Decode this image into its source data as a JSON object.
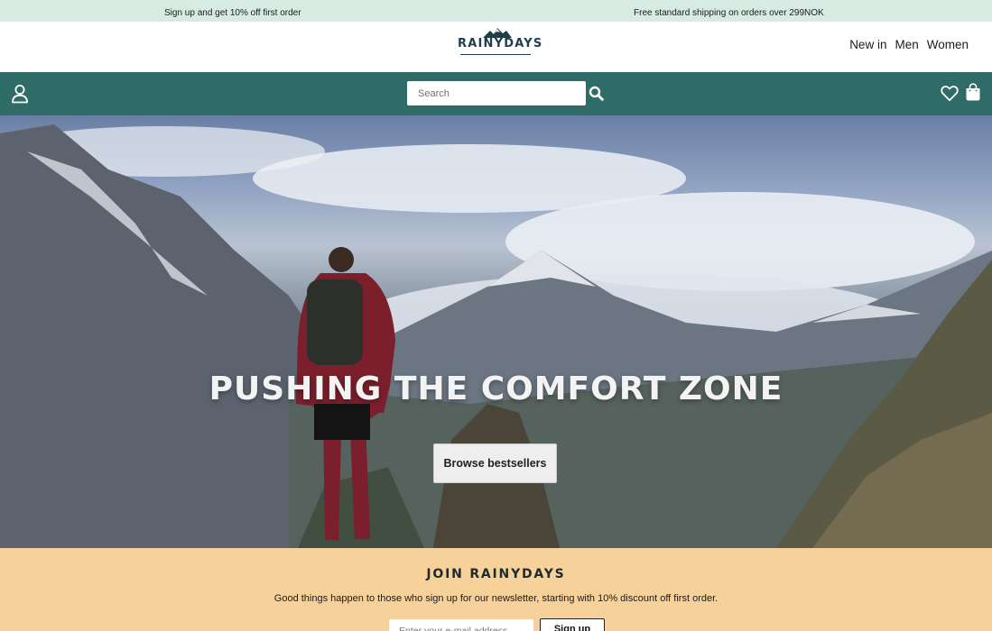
{
  "promo": {
    "signup_offer": "Sign up and get 10% off first order",
    "shipping": "Free standard shipping on orders over 299NOK"
  },
  "header": {
    "logo_text": "RAINYDAYS",
    "nav": {
      "new_in": "New in",
      "men": "Men",
      "women": "Women"
    }
  },
  "search": {
    "placeholder": "Search"
  },
  "icons": {
    "account": "account-icon",
    "search": "search-icon",
    "wishlist": "heart-icon",
    "cart": "shopping-bag-icon"
  },
  "hero": {
    "title": "PUSHING THE COMFORT ZONE",
    "cta_label": "Browse bestsellers"
  },
  "newsletter": {
    "title": "JOIN RAINYDAYS",
    "text": "Good things happen to those who sign up for our newsletter, starting with 10% discount off first order.",
    "email_placeholder": "Enter your e-mail address",
    "signup_label": "Sign up"
  },
  "colors": {
    "promo_bar": "#d7ebe3",
    "search_bar": "#2f6b67",
    "newsletter_bg": "#f6d199",
    "logo": "#1f3e4a"
  }
}
